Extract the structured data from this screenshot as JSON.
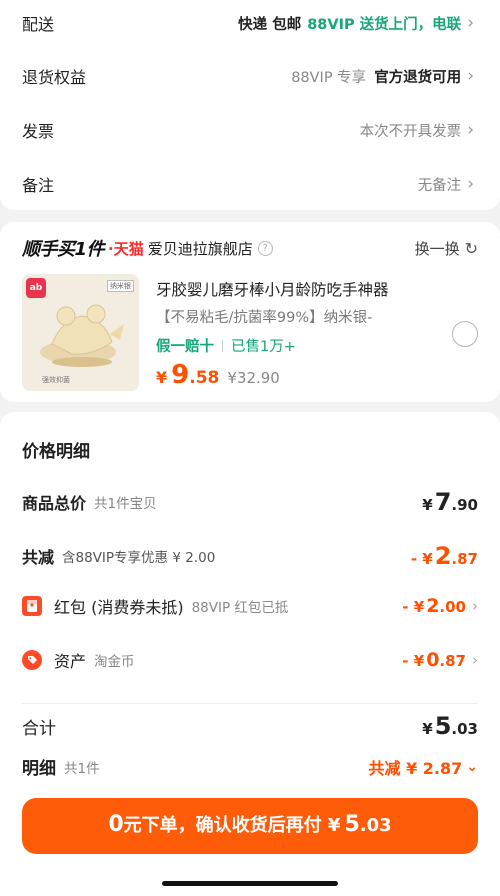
{
  "settings": {
    "delivery": {
      "label": "配送",
      "value_a": "快递 包邮",
      "value_b": "88VIP 送货上门，电联"
    },
    "returns": {
      "label": "退货权益",
      "value_a": "88VIP 专享",
      "value_b": "官方退货可用"
    },
    "invoice": {
      "label": "发票",
      "value": "本次不开具发票"
    },
    "note": {
      "label": "备注",
      "value": "无备注"
    }
  },
  "shop": {
    "logo_text": "顺手买1件",
    "tmall": "天猫",
    "name": "爱贝迪拉旗舰店",
    "swap_label": "换一换"
  },
  "product": {
    "thumb_brand": "ab",
    "thumb_tag": "纳米银",
    "thumb_caption": "强效抑菌",
    "title": "牙胶婴儿磨牙棒小月龄防吃手神器",
    "desc": "【不易粘毛/抗菌率99%】纳米银-",
    "guarantee": "假一赔十",
    "sold": "已售1万+",
    "currency": "¥",
    "price_int": "9",
    "price_dec": ".58",
    "orig_price": "¥32.90"
  },
  "price_detail": {
    "title": "价格明细",
    "total": {
      "label": "商品总价",
      "sub": "共1件宝贝",
      "cur": "¥",
      "int": "7",
      "dec": ".90"
    },
    "discount": {
      "label": "共减",
      "sub": "含88VIP专享优惠 ¥ 2.00",
      "cur": "- ¥",
      "int": "2",
      "dec": ".87"
    },
    "redpacket": {
      "label": "红包 (消费券未抵)",
      "sub": "88VIP 红包已抵",
      "cur": "- ¥",
      "int": "2",
      "dec": ".00"
    },
    "assets": {
      "label": "资产",
      "sub": "淘金币",
      "cur": "- ¥",
      "int": "0",
      "dec": ".87"
    },
    "sum": {
      "label": "合计",
      "cur": "¥",
      "int": "5",
      "dec": ".03"
    },
    "detail": {
      "label": "明细",
      "sub": "共1件",
      "right": "共减 ¥ 2.87"
    }
  },
  "cta": {
    "zero": "0",
    "text": "元下单，确认收货后再付 ¥",
    "amt_int": "5",
    "amt_dec": ".03"
  },
  "colors": {
    "accent": "#ff5000",
    "green": "#18a67a",
    "cta_bg": "#ff5c0a"
  }
}
